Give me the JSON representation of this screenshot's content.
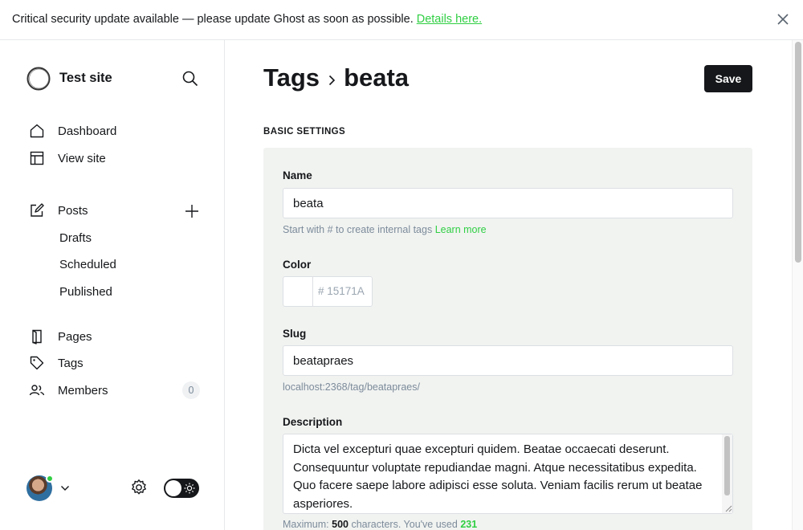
{
  "banner": {
    "message": "Critical security update available — please update Ghost as soon as possible.",
    "link_label": "Details here.",
    "close_icon": "close-icon"
  },
  "sidebar": {
    "site_title": "Test site",
    "nav": [
      {
        "label": "Dashboard",
        "icon": "house-icon"
      },
      {
        "label": "View site",
        "icon": "layout-icon"
      }
    ],
    "posts": {
      "label": "Posts",
      "icon": "pencil-square-icon",
      "sub_items": [
        "Drafts",
        "Scheduled",
        "Published"
      ]
    },
    "pages_label": "Pages",
    "tags_label": "Tags",
    "members_label": "Members",
    "members_count": "0"
  },
  "header": {
    "breadcrumb_parent": "Tags",
    "breadcrumb_current": "beata",
    "save_label": "Save"
  },
  "form": {
    "section_title": "BASIC SETTINGS",
    "name_label": "Name",
    "name_value": "beata",
    "name_hint": "Start with # to create internal tags",
    "name_hint_link": "Learn more",
    "color_label": "Color",
    "color_placeholder": "# 15171A",
    "slug_label": "Slug",
    "slug_value": "beatapraes",
    "slug_url": "localhost:2368/tag/beatapraes/",
    "description_label": "Description",
    "description_value": "Dicta vel excepturi quae excepturi quidem. Beatae occaecati deserunt. Consequuntur voluptate repudiandae magni. Atque necessitatibus expedita. Quo facere saepe labore adipisci esse soluta. Veniam facilis rerum ut beatae asperiores.",
    "char_prefix": "Maximum:",
    "char_max": "500",
    "char_middle": "characters. You've used",
    "char_used": "231"
  },
  "colors": {
    "accent": "#30cf43",
    "dark": "#15171a",
    "muted": "#7c8b9a",
    "panel": "#f1f3f1"
  }
}
